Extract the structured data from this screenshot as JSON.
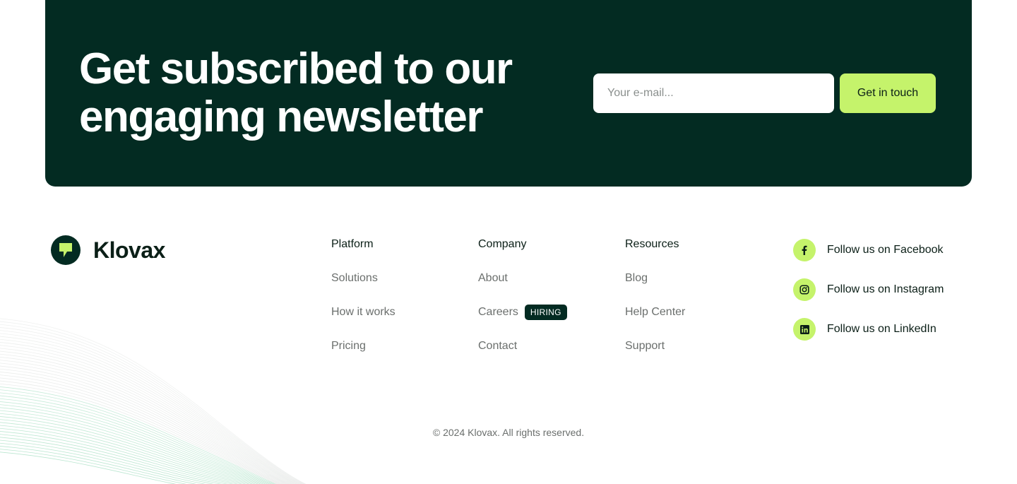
{
  "banner": {
    "title_line1": "Get subscribed to our",
    "title_line2": "engaging newsletter",
    "email_placeholder": "Your e-mail...",
    "cta_label": "Get in touch"
  },
  "brand": {
    "name": "Klovax"
  },
  "columns": [
    {
      "heading": "Platform",
      "items": [
        {
          "label": "Solutions"
        },
        {
          "label": "How it works"
        },
        {
          "label": "Pricing"
        }
      ]
    },
    {
      "heading": "Company",
      "items": [
        {
          "label": "About"
        },
        {
          "label": "Careers",
          "badge": "HIRING"
        },
        {
          "label": "Contact"
        }
      ]
    },
    {
      "heading": "Resources",
      "items": [
        {
          "label": "Blog"
        },
        {
          "label": "Help Center"
        },
        {
          "label": "Support"
        }
      ]
    }
  ],
  "social": [
    {
      "label": "Follow us on Facebook",
      "icon": "facebook-icon"
    },
    {
      "label": "Follow us on Instagram",
      "icon": "instagram-icon"
    },
    {
      "label": "Follow us on LinkedIn",
      "icon": "linkedin-icon"
    }
  ],
  "copyright": "© 2024 Klovax. All rights reserved.",
  "colors": {
    "dark_green": "#032b22",
    "lime": "#c5f36b",
    "muted_text": "#6b6f6d"
  }
}
